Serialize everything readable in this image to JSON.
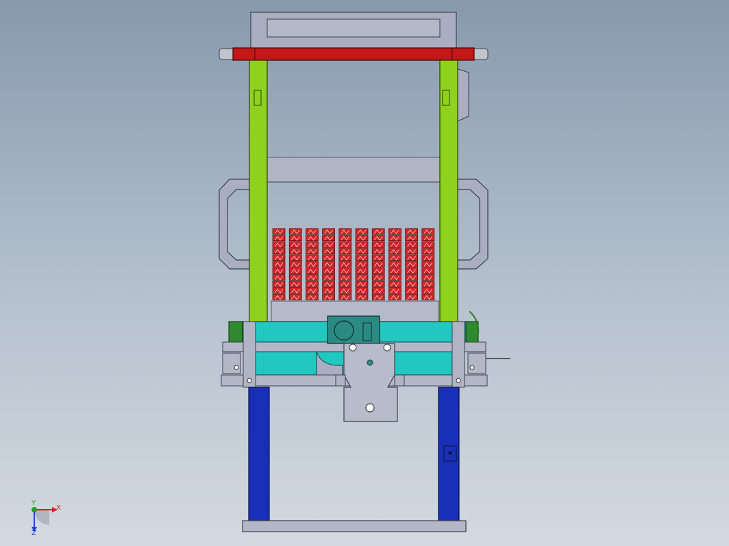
{
  "triad": {
    "x_label": "X",
    "y_label": "Y",
    "z_label": "Z",
    "x_color": "#d02020",
    "y_color": "#20a020",
    "z_color": "#2040d0"
  },
  "colors": {
    "frame_gray": "#a9aec0",
    "green_post": "#8fd21e",
    "blue_post": "#1a2fb8",
    "red_bar": "#c41818",
    "cyan_plate": "#20c8c0",
    "dark_green_block": "#2e8a2e",
    "teal_block": "#2c8a84",
    "red_parts": "#d02424"
  },
  "parts": {
    "rack_columns": 10,
    "rack_rows": 11
  }
}
